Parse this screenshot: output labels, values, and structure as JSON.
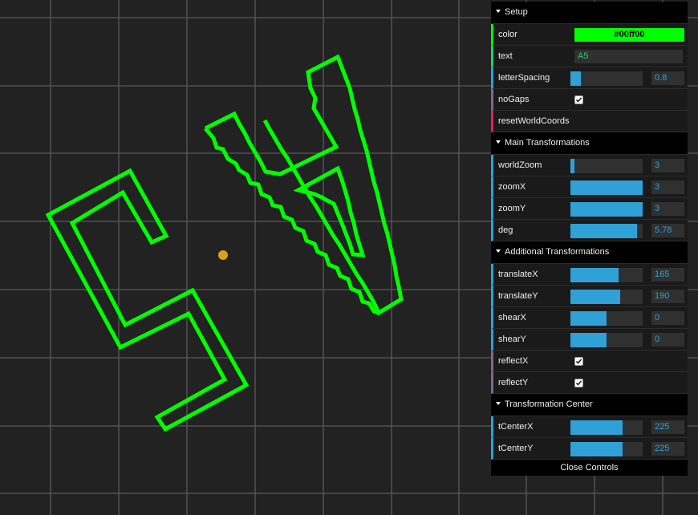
{
  "canvas": {
    "background": "#222222",
    "grid_color": "#555555",
    "shape_color": "#00ff00",
    "origin_color": "#e0a010"
  },
  "gui": {
    "setup": {
      "title": "Setup",
      "color_label": "color",
      "color_value": "#00ff00",
      "text_label": "text",
      "text_value": "A5",
      "letterSpacing_label": "letterSpacing",
      "letterSpacing_value": "0.8",
      "letterSpacing_fill": 0.14,
      "noGaps_label": "noGaps",
      "noGaps_checked": true,
      "reset_label": "resetWorldCoords"
    },
    "main": {
      "title": "Main Transformations",
      "worldZoom_label": "worldZoom",
      "worldZoom_value": "3",
      "worldZoom_fill": 0.06,
      "zoomX_label": "zoomX",
      "zoomX_value": "3",
      "zoomX_fill": 1.0,
      "zoomY_label": "zoomY",
      "zoomY_value": "3",
      "zoomY_fill": 1.0,
      "deg_label": "deg",
      "deg_value": "5.78",
      "deg_fill": 0.92
    },
    "additional": {
      "title": "Additional Transformations",
      "translateX_label": "translateX",
      "translateX_value": "165",
      "translateX_fill": 0.67,
      "translateY_label": "translateY",
      "translateY_value": "190",
      "translateY_fill": 0.69,
      "shearX_label": "shearX",
      "shearX_value": "0",
      "shearX_fill": 0.5,
      "shearY_label": "shearY",
      "shearY_value": "0",
      "shearY_fill": 0.5,
      "reflectX_label": "reflectX",
      "reflectX_checked": true,
      "reflectY_label": "reflectY",
      "reflectY_checked": true
    },
    "center": {
      "title": "Transformation Center",
      "tCenterX_label": "tCenterX",
      "tCenterX_value": "225",
      "tCenterX_fill": 0.72,
      "tCenterY_label": "tCenterY",
      "tCenterY_value": "225",
      "tCenterY_fill": 0.72
    },
    "close_label": "Close Controls"
  }
}
